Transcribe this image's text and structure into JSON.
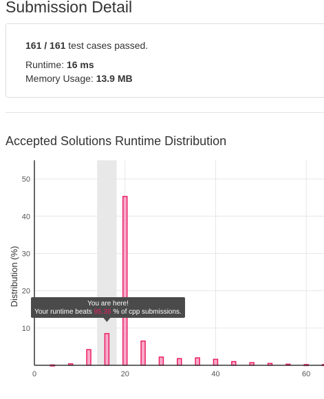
{
  "page": {
    "title": "Submission Detail",
    "distribution_title": "Accepted Solutions Runtime Distribution"
  },
  "summary": {
    "passed": "161 / 161",
    "passed_suffix": "test cases passed.",
    "runtime_label": "Runtime:",
    "runtime_value": "16 ms",
    "memory_label": "Memory Usage:",
    "memory_value": "13.9 MB"
  },
  "colors": {
    "bar_fill": "#f9a8c9",
    "bar_stroke": "#e91e63",
    "highlight_band": "#e8e8e8",
    "tooltip_bg": "#4a4a4a",
    "tooltip_text": "#ffffff",
    "tooltip_accent": "#e91e63"
  },
  "chart_data": {
    "type": "bar",
    "ylabel": "Distribution (%)",
    "xlabel": "",
    "xlim": [
      0,
      66
    ],
    "ylim": [
      0,
      55
    ],
    "x_ticks": [
      "0",
      "20",
      "40",
      "60"
    ],
    "y_ticks": [
      "10",
      "20",
      "30",
      "40",
      "50"
    ],
    "x_tick_values": [
      0,
      20,
      40,
      60
    ],
    "y_tick_values": [
      10,
      20,
      30,
      40,
      50
    ],
    "highlight": {
      "from": 14,
      "to": 18
    },
    "x": [
      4,
      8,
      12,
      16,
      20,
      24,
      28,
      32,
      36,
      40,
      44,
      48,
      52,
      56,
      60,
      64
    ],
    "values": [
      0.1,
      0.4,
      4.2,
      8.5,
      45.3,
      6.5,
      2.2,
      1.8,
      2.0,
      1.6,
      1.0,
      0.7,
      0.5,
      0.3,
      0.2,
      0.2
    ],
    "tooltip": {
      "line1": "You are here!",
      "line2_prefix": "Your runtime beats ",
      "percent": "95.36",
      "line2_suffix": " % of cpp submissions.",
      "at_x": 16
    }
  }
}
